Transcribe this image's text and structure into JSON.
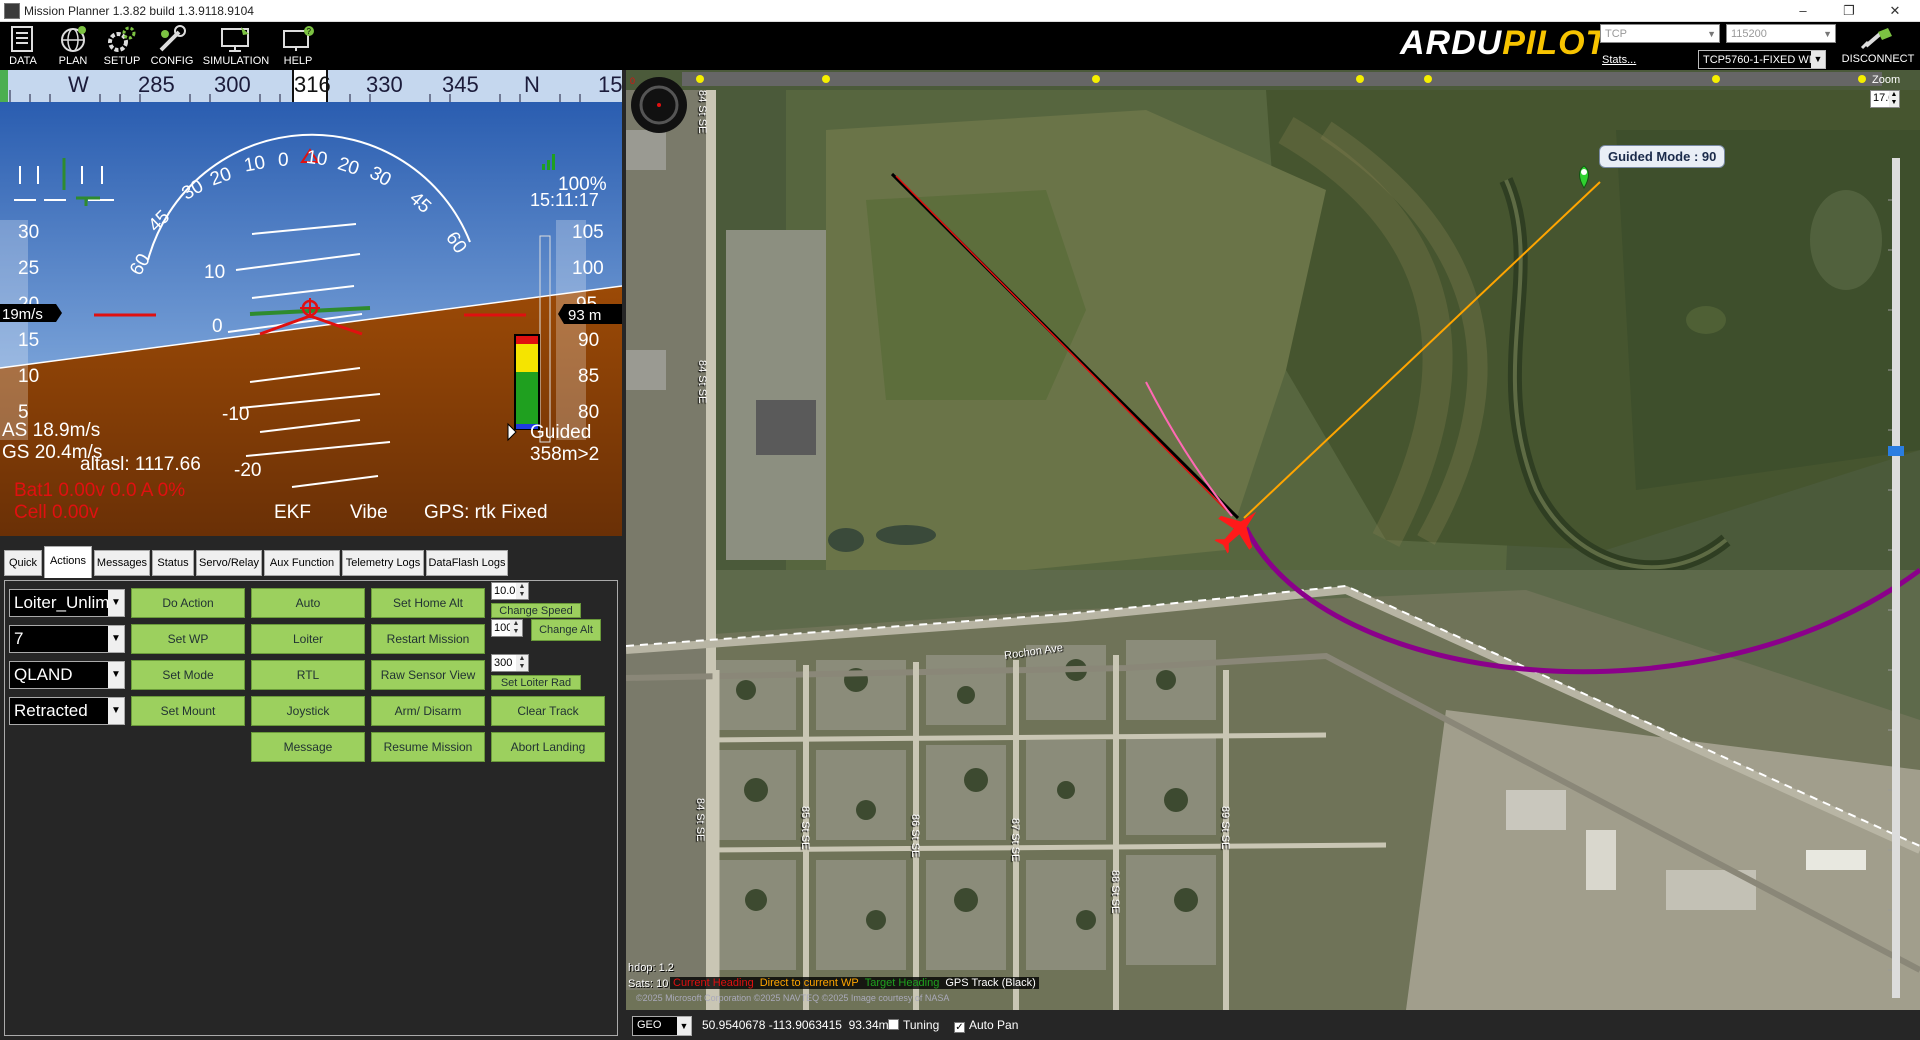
{
  "window": {
    "title": "Mission Planner 1.3.82 build 1.3.9118.9104"
  },
  "toolbar": {
    "buttons": [
      {
        "label": "DATA"
      },
      {
        "label": "PLAN"
      },
      {
        "label": "SETUP"
      },
      {
        "label": "CONFIG"
      },
      {
        "label": "SIMULATION"
      },
      {
        "label": "HELP"
      }
    ],
    "logo_a": "ARDU",
    "logo_b": "PILOT",
    "conn_type": "TCP",
    "baud": "115200",
    "stats_link": "Stats...",
    "connection": "TCP5760-1-FIXED WIN",
    "disconnect": "DISCONNECT"
  },
  "hud": {
    "compass": {
      "W": "W",
      "h285": "285",
      "h300": "300",
      "current": "316",
      "h330": "330",
      "h345": "345",
      "N": "N",
      "h15": "15"
    },
    "battery_pct": "100%",
    "time": "15:11:17",
    "speed_ticks": [
      "30",
      "25",
      "20",
      "15",
      "10",
      "5"
    ],
    "alt_ticks": [
      "105",
      "100",
      "95",
      "90",
      "85",
      "80"
    ],
    "pitch_left": [
      "10",
      "0",
      "-10",
      "-20"
    ],
    "roll_scale": [
      "60",
      "45",
      "30",
      "20",
      "10",
      "0",
      "10",
      "20",
      "30",
      "45",
      "60"
    ],
    "speed_box": "19m/s",
    "alt_box": "93 m",
    "airspeed": "AS 18.9m/s",
    "groundspeed": "GS 20.4m/s",
    "altasl": "altasl: 1117.66",
    "mode": "Guided",
    "wp_info": "358m>2",
    "bat": "Bat1 0.00v 0.0 A 0%",
    "cell": "Cell 0.00v",
    "ekf": "EKF",
    "vibe": "Vibe",
    "gps": "GPS: rtk Fixed"
  },
  "tabs": [
    "Quick",
    "Actions",
    "Messages",
    "Status",
    "Servo/Relay",
    "Aux Function",
    "Telemetry Logs",
    "DataFlash Logs"
  ],
  "actions": {
    "selects": [
      "Loiter_Unlim",
      "7",
      "QLAND",
      "Retracted"
    ],
    "col1": [
      "Do Action",
      "Set WP",
      "Set Mode",
      "Set Mount"
    ],
    "col2": [
      "Auto",
      "Loiter",
      "RTL",
      "Joystick",
      "Message"
    ],
    "col3": [
      "Set Home Alt",
      "Restart Mission",
      "Raw Sensor View",
      "Arm/ Disarm",
      "Resume Mission"
    ],
    "col4": [
      "Clear Track",
      "Abort Landing"
    ],
    "speed_value": "10.0",
    "speed_btn": "Change Speed",
    "alt_value": "100",
    "alt_btn": "Change Alt",
    "loiter_value": "300",
    "loiter_btn": "Set Loiter Rad"
  },
  "map": {
    "guided_label": "Guided Mode : 90",
    "zoom_label": "Zoom",
    "zoom_value": "17.0",
    "hdop": "hdop: 1.2",
    "sats": "Sats: 10",
    "legend": [
      "Current Heading",
      "Direct to current WP",
      "Target Heading",
      "GPS Track (Black)"
    ],
    "copyright": "©2025 Microsoft Corporation ©2025 NAVTEQ ©2025 Image courtesy of NASA",
    "roads": [
      "84 St SE",
      "84 St SE",
      "84 St SE",
      "85 St SE",
      "86 St SE",
      "87 St SE",
      "88 St SE",
      "89 St SE",
      "Rochon Ave"
    ],
    "colors": {
      "track": "#000000",
      "heading": "#ff0000",
      "to_wp": "#ffa500",
      "target": "#ff69b4",
      "loiter": "#8b008b"
    }
  },
  "status": {
    "coord_type": "GEO",
    "coords": "50.9540678 -113.9063415",
    "alt": "93.34m",
    "tuning": "Tuning",
    "autopan": "Auto Pan"
  }
}
